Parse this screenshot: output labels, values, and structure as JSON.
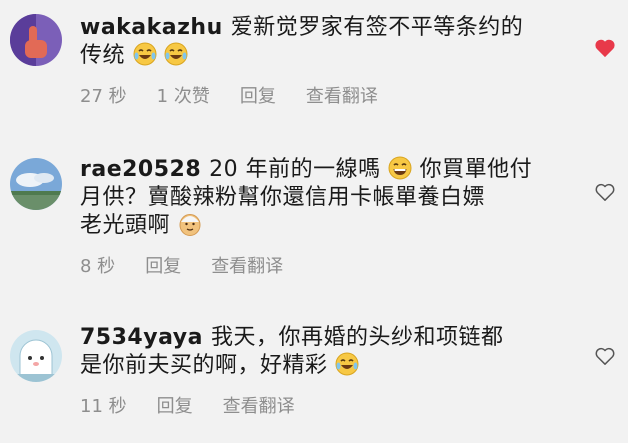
{
  "comments": [
    {
      "username": "wakakazhu",
      "text_line1": "爱新觉罗家有签不平等条约的",
      "text_line2": "传统",
      "time": "27 秒",
      "likes": "1 次赞",
      "reply": "回复",
      "translate": "查看翻译",
      "liked": true,
      "avatar_icon": "purple-hand-avatar",
      "emoji": [
        "tears-of-joy-emoji",
        "tears-of-joy-emoji"
      ]
    },
    {
      "username": "rae20528",
      "text_line1": "20 年前的一線嗎",
      "text_line1b": "你買單他付",
      "text_line2": "月供？賣酸辣粉幫你還信用卡帳單養白嫖",
      "text_line3": "老光頭啊",
      "time": "8 秒",
      "reply": "回复",
      "translate": "查看翻译",
      "liked": false,
      "avatar_icon": "sky-landscape-avatar",
      "emoji": [
        "grinning-emoji",
        "old-man-emoji"
      ]
    },
    {
      "username": "7534yaya",
      "text_line1": "我天，你再婚的头纱和项链都",
      "text_line2": "是你前夫买的啊，好精彩",
      "time": "11 秒",
      "reply": "回复",
      "translate": "查看翻译",
      "liked": false,
      "avatar_icon": "cartoon-ghost-avatar",
      "emoji": [
        "tears-of-joy-emoji"
      ]
    }
  ],
  "colors": {
    "heart_liked": "#e8394a",
    "meta": "#8e8e8e",
    "background": "#f2f2f2"
  }
}
